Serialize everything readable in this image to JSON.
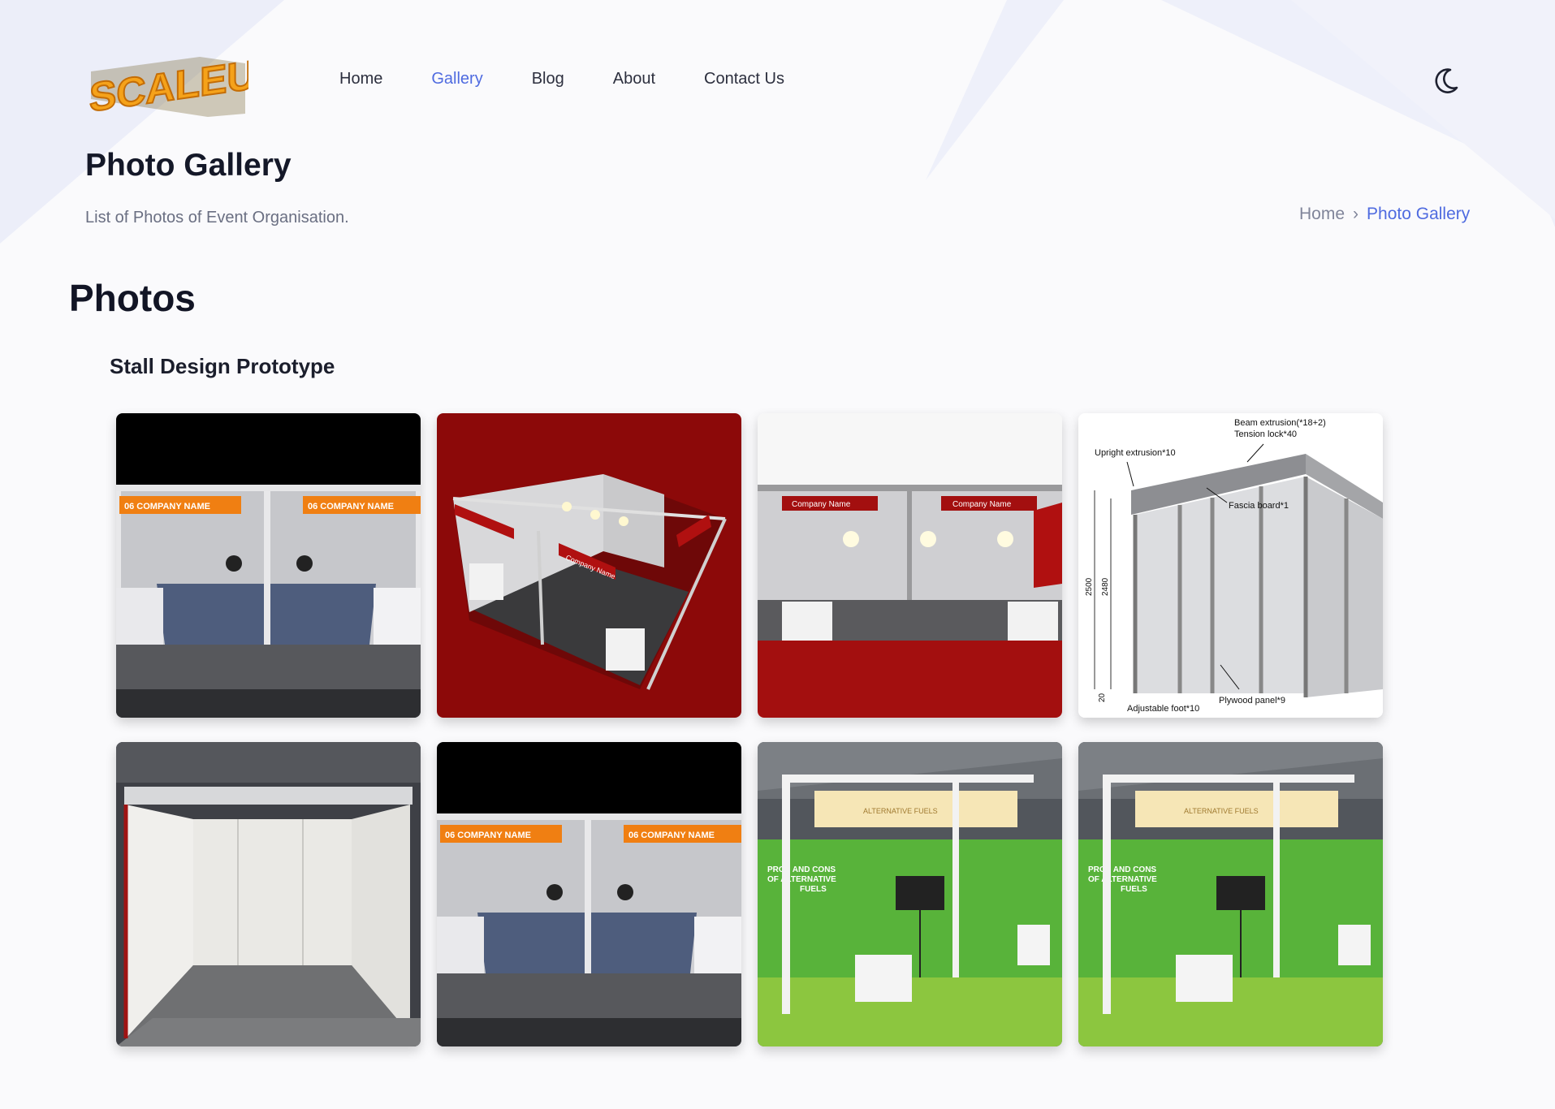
{
  "header": {
    "logo_text": "SCALEUP",
    "nav": [
      {
        "label": "Home",
        "active": false
      },
      {
        "label": "Gallery",
        "active": true
      },
      {
        "label": "Blog",
        "active": false
      },
      {
        "label": "About",
        "active": false
      },
      {
        "label": "Contact Us",
        "active": false
      }
    ],
    "theme_toggle_icon": "moon-icon"
  },
  "hero": {
    "title": "Photo Gallery",
    "subtitle": "List of Photos of Event Organisation.",
    "breadcrumb": {
      "home": "Home",
      "separator": "›",
      "current": "Photo Gallery"
    }
  },
  "main": {
    "section_title": "Photos",
    "album": {
      "title": "Stall Design Prototype",
      "photos": [
        {
          "kind": "render-dual",
          "labels": [
            "06  COMPANY NAME",
            "06  COMPANY NAME"
          ]
        },
        {
          "kind": "render-red-iso",
          "labels": [
            "Company Name",
            "Company Name"
          ]
        },
        {
          "kind": "render-red-front",
          "labels": [
            "Company Name",
            "Company Name"
          ]
        },
        {
          "kind": "diagram",
          "labels": [
            "Beam extrusion(*18+2)",
            "Tension lock*40",
            "Upright extrusion*10",
            "Fascia board*1",
            "2500",
            "2480",
            "20",
            "Adjustable foot*10",
            "Plywood panel*9"
          ]
        },
        {
          "kind": "photo-white-booth",
          "labels": []
        },
        {
          "kind": "render-dual",
          "labels": [
            "06  COMPANY NAME",
            "06  COMPANY NAME"
          ]
        },
        {
          "kind": "photo-green-booth",
          "labels": [
            "PROS AND CONS OF ALTERNATIVE FUELS",
            "ALTERNATIVE FUELS"
          ]
        },
        {
          "kind": "photo-green-booth",
          "labels": [
            "PROS AND CONS OF ALTERNATIVE FUELS",
            "ALTERNATIVE FUELS"
          ]
        }
      ]
    }
  },
  "colors": {
    "accent": "#4f6be0",
    "logo_orange": "#f29a14",
    "booth_red": "#8e0a0a",
    "label_orange": "#f07f12"
  }
}
